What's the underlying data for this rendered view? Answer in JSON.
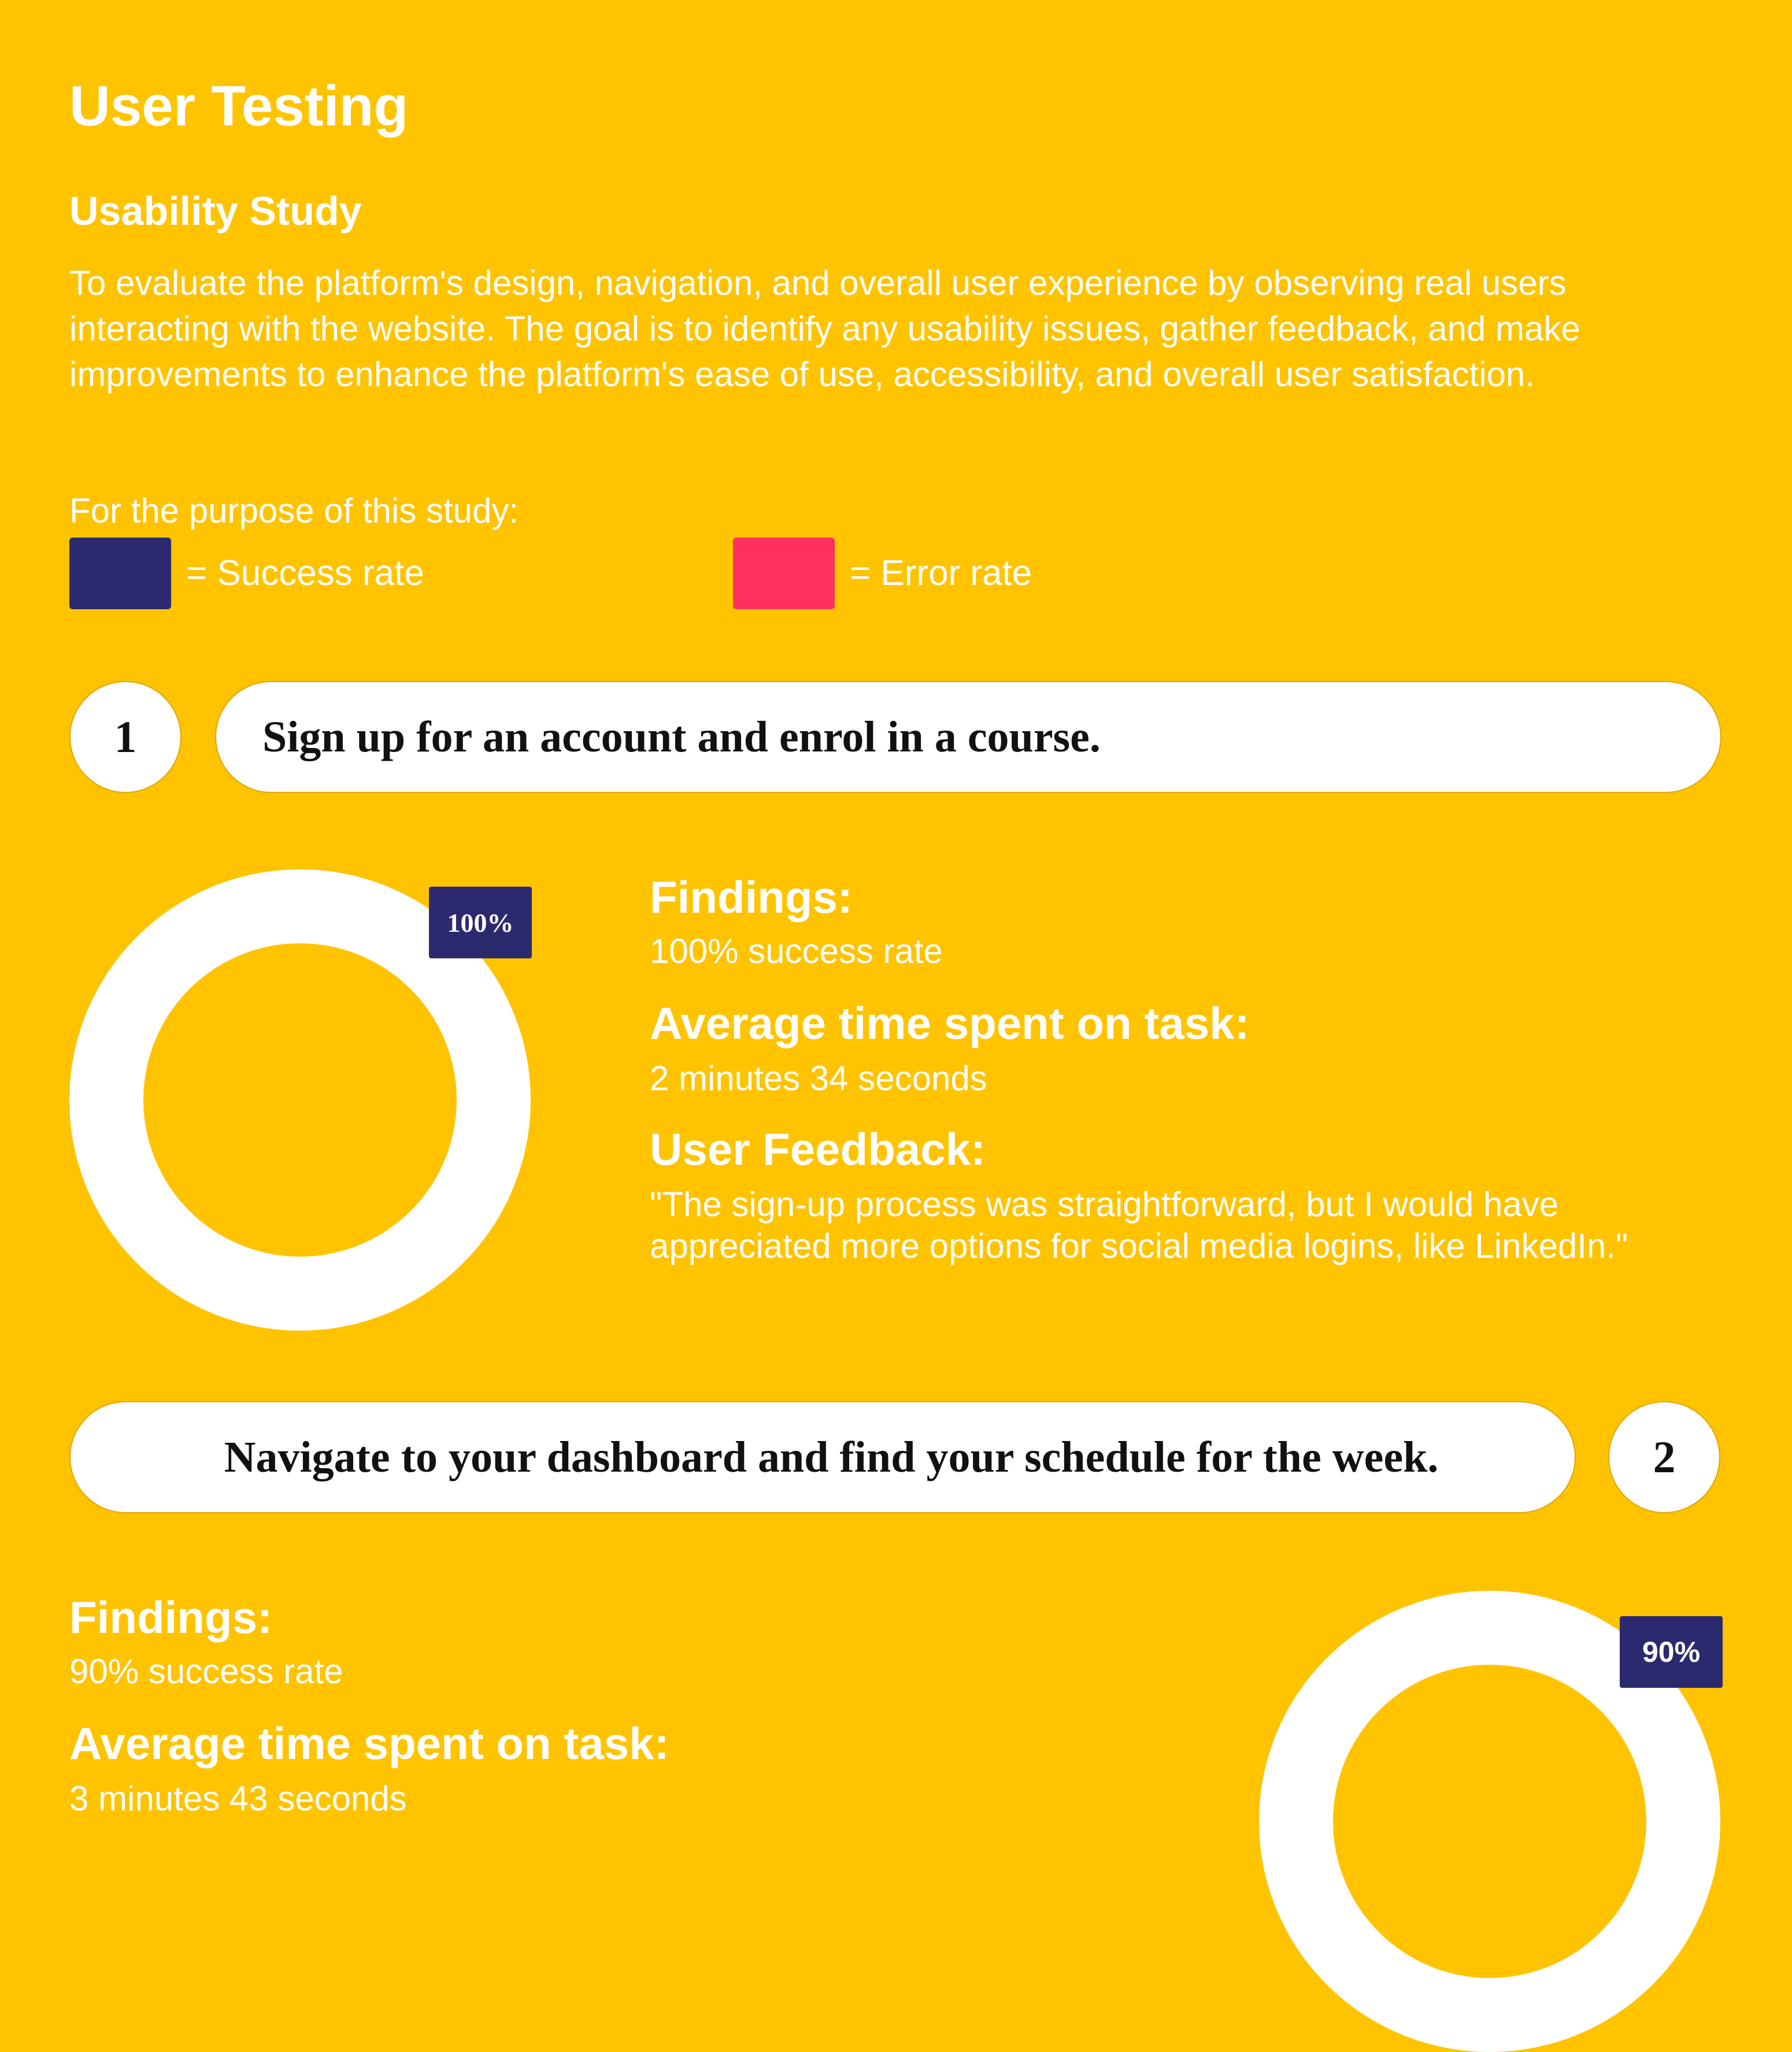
{
  "header": {
    "title": "User Testing",
    "subtitle": "Usability Study",
    "intro": "To evaluate the platform's design, navigation, and overall user experience by observing real users interacting with the website. The goal is to identify any usability issues, gather feedback, and make improvements to enhance the platform's ease of use, accessibility, and overall user satisfaction."
  },
  "legend": {
    "purpose": "For the purpose of this study:",
    "success_label": "= Success rate",
    "error_label": "= Error rate",
    "success_color": "#2B2A6E",
    "error_color": "#FF305E"
  },
  "tasks": [
    {
      "number": "1",
      "description": "Sign up for an account and enrol in a course.",
      "success_percent": 100,
      "badge": "100%",
      "findings_heading": "Findings:",
      "findings": "100% success rate",
      "time_heading": "Average time spent on task:",
      "time": "2 minutes 34 seconds",
      "feedback_heading": "User Feedback:",
      "feedback": "\"The sign-up process was straightforward, but I would have appreciated more options for social media logins, like LinkedIn.\""
    },
    {
      "number": "2",
      "description": "Navigate to your dashboard and find your schedule for the week.",
      "success_percent": 90,
      "badge": "90%",
      "findings_heading": "Findings:",
      "findings": "90% success rate",
      "time_heading": "Average time spent on task:",
      "time": "3 minutes 43 seconds"
    }
  ]
}
